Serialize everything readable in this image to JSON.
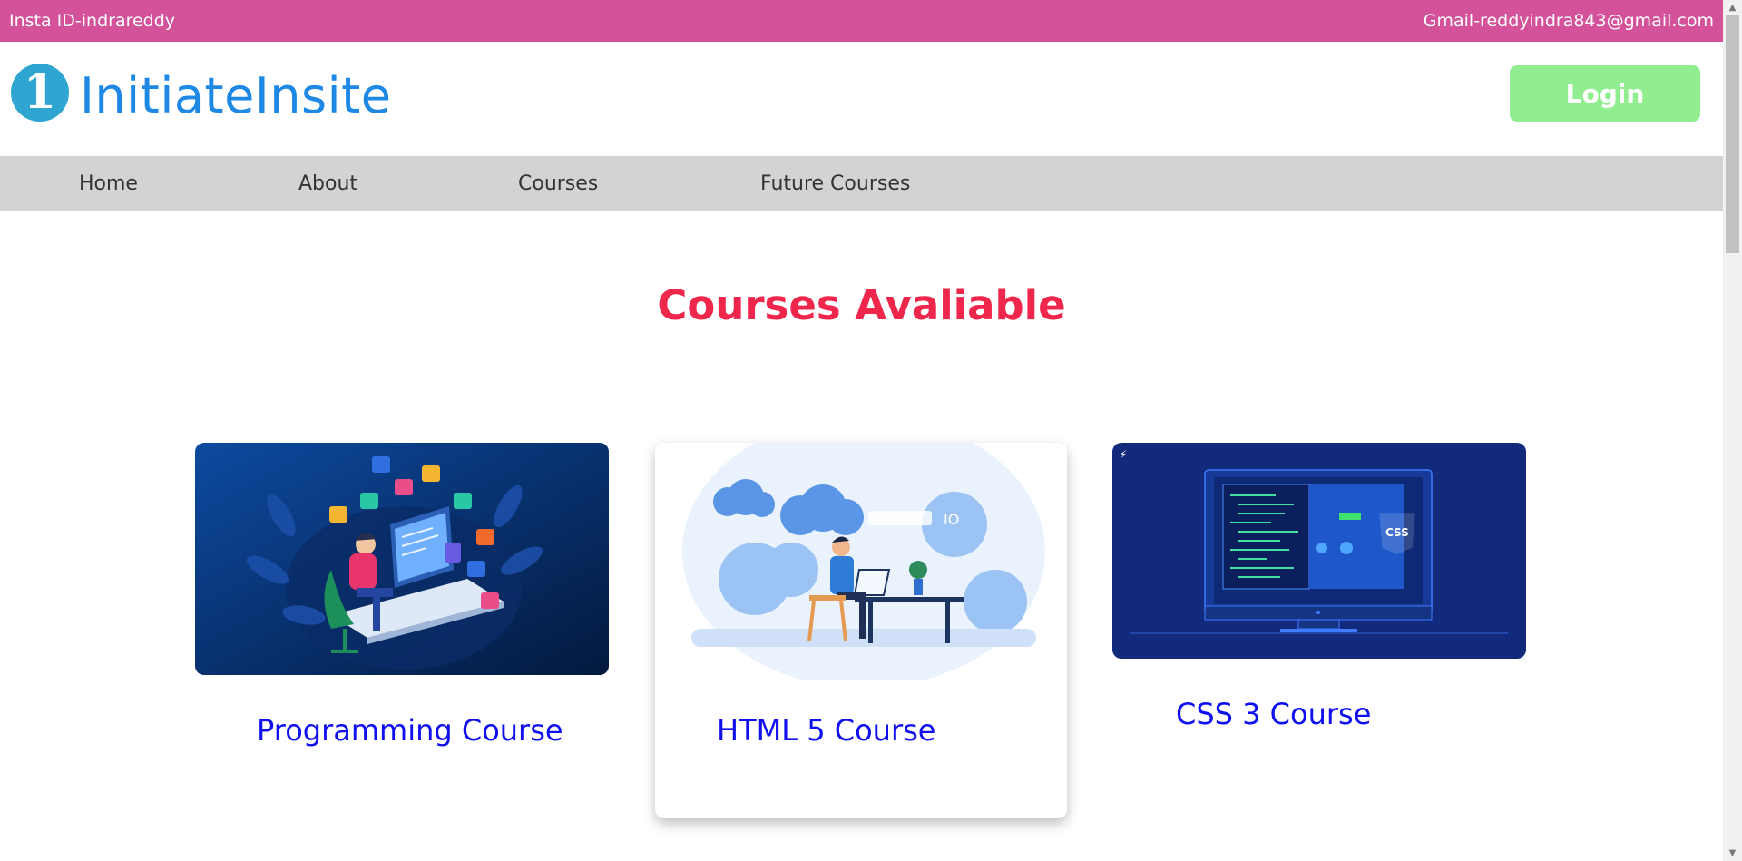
{
  "topbar": {
    "insta": "Insta ID-indrareddy",
    "gmail": "Gmail-reddyindra843@gmail.com",
    "color": "#d35299"
  },
  "header": {
    "logo_glyph": "1",
    "brand": "InitiateInsite",
    "login_label": "Login",
    "login_color": "#90ee90"
  },
  "nav": {
    "items": [
      {
        "label": "Home"
      },
      {
        "label": "About"
      },
      {
        "label": "Courses"
      },
      {
        "label": "Future Courses"
      }
    ]
  },
  "main": {
    "title": "Courses Avaliable",
    "title_color": "#f0274d",
    "cards": [
      {
        "title": "Programming Course",
        "image": "developer-workstation-illustration"
      },
      {
        "title": "HTML 5 Course",
        "image": "person-laptop-cloud-illustration"
      },
      {
        "title": "CSS 3 Course",
        "image": "css-monitor-illustration"
      }
    ]
  },
  "scrollbar": {
    "up": "▲",
    "down": "▼"
  }
}
